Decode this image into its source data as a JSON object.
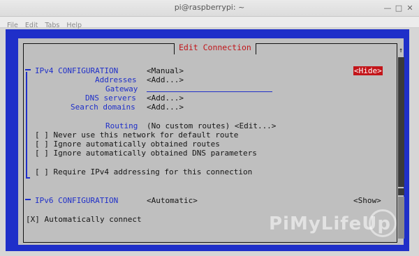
{
  "window": {
    "title": "pi@raspberrypi: ~"
  },
  "menu": [
    "File",
    "Edit",
    "Tabs",
    "Help"
  ],
  "dialog": {
    "title": "Edit Connection"
  },
  "ipv4": {
    "header": "IPv4 CONFIGURATION",
    "method": "<Manual>",
    "hide_button": "<Hide>",
    "addresses_label": "Addresses",
    "addresses_value": "<Add...>",
    "gateway_label": "Gateway",
    "dns_label": "DNS servers",
    "dns_value": "<Add...>",
    "search_label": "Search domains",
    "search_value": "<Add...>",
    "routing_label": "Routing",
    "routing_value": "(No custom routes) <Edit...>",
    "checkboxes": [
      "[ ] Never use this network for default route",
      "[ ] Ignore automatically obtained routes",
      "[ ] Ignore automatically obtained DNS parameters",
      "[ ] Require IPv4 addressing for this connection"
    ]
  },
  "ipv6": {
    "header": "IPv6 CONFIGURATION",
    "method": "<Automatic>",
    "show_button": "<Show>"
  },
  "auto_connect": "[X] Automatically connect",
  "scroll_up_arrow": "↑",
  "watermark": "PiMyLifeUp",
  "colors": {
    "terminal_bg": "#1f2fc9",
    "dialog_bg": "#bfbfbf",
    "accent": "#1f2fc9",
    "title_red": "#c0151a",
    "focus_red": "#c3151a"
  }
}
